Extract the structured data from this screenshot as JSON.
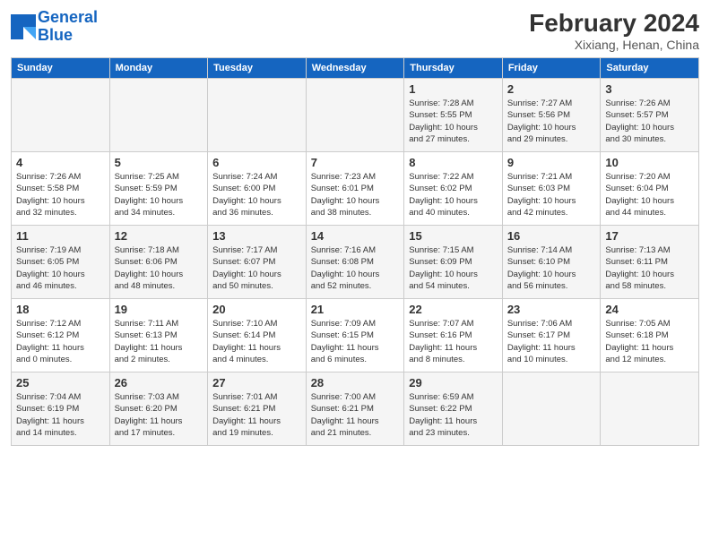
{
  "header": {
    "logo_line1": "General",
    "logo_line2": "Blue",
    "month": "February 2024",
    "location": "Xixiang, Henan, China"
  },
  "days_of_week": [
    "Sunday",
    "Monday",
    "Tuesday",
    "Wednesday",
    "Thursday",
    "Friday",
    "Saturday"
  ],
  "weeks": [
    [
      {
        "day": "",
        "info": ""
      },
      {
        "day": "",
        "info": ""
      },
      {
        "day": "",
        "info": ""
      },
      {
        "day": "",
        "info": ""
      },
      {
        "day": "1",
        "info": "Sunrise: 7:28 AM\nSunset: 5:55 PM\nDaylight: 10 hours\nand 27 minutes."
      },
      {
        "day": "2",
        "info": "Sunrise: 7:27 AM\nSunset: 5:56 PM\nDaylight: 10 hours\nand 29 minutes."
      },
      {
        "day": "3",
        "info": "Sunrise: 7:26 AM\nSunset: 5:57 PM\nDaylight: 10 hours\nand 30 minutes."
      }
    ],
    [
      {
        "day": "4",
        "info": "Sunrise: 7:26 AM\nSunset: 5:58 PM\nDaylight: 10 hours\nand 32 minutes."
      },
      {
        "day": "5",
        "info": "Sunrise: 7:25 AM\nSunset: 5:59 PM\nDaylight: 10 hours\nand 34 minutes."
      },
      {
        "day": "6",
        "info": "Sunrise: 7:24 AM\nSunset: 6:00 PM\nDaylight: 10 hours\nand 36 minutes."
      },
      {
        "day": "7",
        "info": "Sunrise: 7:23 AM\nSunset: 6:01 PM\nDaylight: 10 hours\nand 38 minutes."
      },
      {
        "day": "8",
        "info": "Sunrise: 7:22 AM\nSunset: 6:02 PM\nDaylight: 10 hours\nand 40 minutes."
      },
      {
        "day": "9",
        "info": "Sunrise: 7:21 AM\nSunset: 6:03 PM\nDaylight: 10 hours\nand 42 minutes."
      },
      {
        "day": "10",
        "info": "Sunrise: 7:20 AM\nSunset: 6:04 PM\nDaylight: 10 hours\nand 44 minutes."
      }
    ],
    [
      {
        "day": "11",
        "info": "Sunrise: 7:19 AM\nSunset: 6:05 PM\nDaylight: 10 hours\nand 46 minutes."
      },
      {
        "day": "12",
        "info": "Sunrise: 7:18 AM\nSunset: 6:06 PM\nDaylight: 10 hours\nand 48 minutes."
      },
      {
        "day": "13",
        "info": "Sunrise: 7:17 AM\nSunset: 6:07 PM\nDaylight: 10 hours\nand 50 minutes."
      },
      {
        "day": "14",
        "info": "Sunrise: 7:16 AM\nSunset: 6:08 PM\nDaylight: 10 hours\nand 52 minutes."
      },
      {
        "day": "15",
        "info": "Sunrise: 7:15 AM\nSunset: 6:09 PM\nDaylight: 10 hours\nand 54 minutes."
      },
      {
        "day": "16",
        "info": "Sunrise: 7:14 AM\nSunset: 6:10 PM\nDaylight: 10 hours\nand 56 minutes."
      },
      {
        "day": "17",
        "info": "Sunrise: 7:13 AM\nSunset: 6:11 PM\nDaylight: 10 hours\nand 58 minutes."
      }
    ],
    [
      {
        "day": "18",
        "info": "Sunrise: 7:12 AM\nSunset: 6:12 PM\nDaylight: 11 hours\nand 0 minutes."
      },
      {
        "day": "19",
        "info": "Sunrise: 7:11 AM\nSunset: 6:13 PM\nDaylight: 11 hours\nand 2 minutes."
      },
      {
        "day": "20",
        "info": "Sunrise: 7:10 AM\nSunset: 6:14 PM\nDaylight: 11 hours\nand 4 minutes."
      },
      {
        "day": "21",
        "info": "Sunrise: 7:09 AM\nSunset: 6:15 PM\nDaylight: 11 hours\nand 6 minutes."
      },
      {
        "day": "22",
        "info": "Sunrise: 7:07 AM\nSunset: 6:16 PM\nDaylight: 11 hours\nand 8 minutes."
      },
      {
        "day": "23",
        "info": "Sunrise: 7:06 AM\nSunset: 6:17 PM\nDaylight: 11 hours\nand 10 minutes."
      },
      {
        "day": "24",
        "info": "Sunrise: 7:05 AM\nSunset: 6:18 PM\nDaylight: 11 hours\nand 12 minutes."
      }
    ],
    [
      {
        "day": "25",
        "info": "Sunrise: 7:04 AM\nSunset: 6:19 PM\nDaylight: 11 hours\nand 14 minutes."
      },
      {
        "day": "26",
        "info": "Sunrise: 7:03 AM\nSunset: 6:20 PM\nDaylight: 11 hours\nand 17 minutes."
      },
      {
        "day": "27",
        "info": "Sunrise: 7:01 AM\nSunset: 6:21 PM\nDaylight: 11 hours\nand 19 minutes."
      },
      {
        "day": "28",
        "info": "Sunrise: 7:00 AM\nSunset: 6:21 PM\nDaylight: 11 hours\nand 21 minutes."
      },
      {
        "day": "29",
        "info": "Sunrise: 6:59 AM\nSunset: 6:22 PM\nDaylight: 11 hours\nand 23 minutes."
      },
      {
        "day": "",
        "info": ""
      },
      {
        "day": "",
        "info": ""
      }
    ]
  ]
}
